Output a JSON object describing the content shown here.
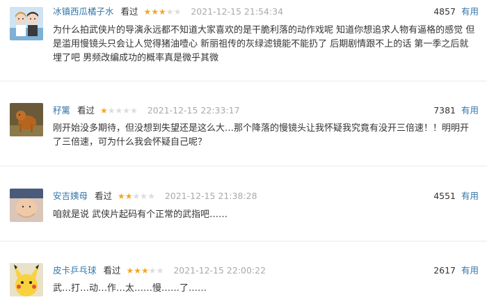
{
  "comments": [
    {
      "user": "冰镇西瓜橘子水",
      "status": "看过",
      "rating": 3,
      "time": "2021-12-15 21:54:34",
      "votes": "4857",
      "useful_label": "有用",
      "text": "为什么拍武侠片的导演永远都不知道大家喜欢的是干脆利落的动作戏呢 知道你想追求人物有逼格的感觉 但是滥用慢镜头只会让人觉得猪油噎心 新丽祖传的灰绿滤镜能不能扔了 后期剧情跟不上的话 第一季之后就埋了吧 男频改编成功的概率真是微乎其微",
      "avatar": "cartoon-couple-avatar"
    },
    {
      "user": "秄篱",
      "status": "看过",
      "rating": 1,
      "time": "2021-12-15 22:33:17",
      "votes": "7381",
      "useful_label": "有用",
      "text": "刚开始没多期待，但没想到失望还是这么大…那个降落的慢镜头让我怀疑我究竟有没开三倍速！！明明开了三倍速，可为什么我会怀疑自己呢？",
      "avatar": "dog-photo-avatar"
    },
    {
      "user": "安吉姨母",
      "status": "看过",
      "rating": 2,
      "time": "2021-12-15 21:38:28",
      "votes": "4551",
      "useful_label": "有用",
      "text": "咱就是说 武侠片起码有个正常的武指吧……",
      "avatar": "baby-photo-avatar"
    },
    {
      "user": "皮卡乒乓球",
      "status": "看过",
      "rating": 3,
      "time": "2021-12-15 22:00:22",
      "votes": "2617",
      "useful_label": "有用",
      "text": "武…打…动…作…太……慢……了……",
      "avatar": "pikachu-avatar"
    }
  ],
  "colors": {
    "link": "#3377aa",
    "star_on": "#f5a623",
    "star_off": "#dcdcdc",
    "time": "#aaaaaa"
  }
}
